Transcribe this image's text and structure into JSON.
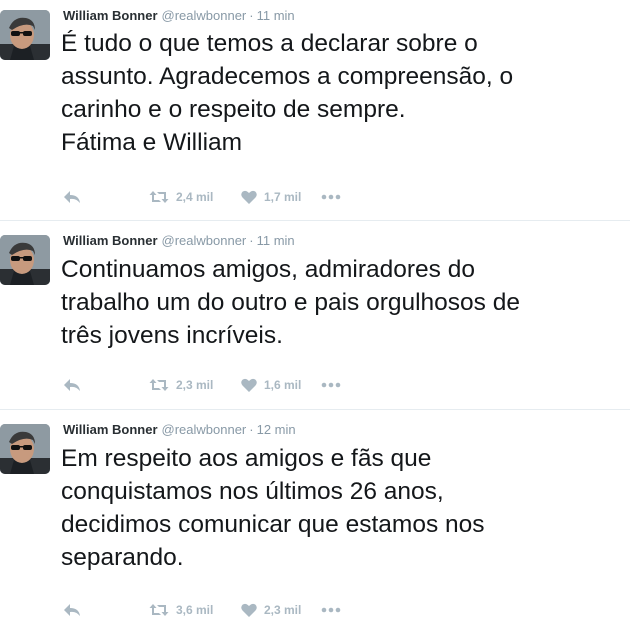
{
  "tweets": [
    {
      "name": "William Bonner",
      "handle": "@realwbonner",
      "separator": "·",
      "time": "11 min",
      "text": "É tudo o que temos a declarar sobre o\nassunto. Agradecemos a compreensão, o\ncarinho e o respeito de sempre.\nFátima e William",
      "retweets": "2,4 mil",
      "likes": "1,7 mil"
    },
    {
      "name": "William Bonner",
      "handle": "@realwbonner",
      "separator": "·",
      "time": "11 min",
      "text": "Continuamos amigos, admiradores do\ntrabalho um do outro e pais orgulhosos de\ntrês jovens incríveis.",
      "retweets": "2,3 mil",
      "likes": "1,6 mil"
    },
    {
      "name": "William Bonner",
      "handle": "@realwbonner",
      "separator": "·",
      "time": "12 min",
      "text": "Em respeito aos amigos e fãs que\nconquistamos nos últimos 26 anos,\ndecidimos comunicar que estamos nos\nseparando.",
      "retweets": "3,6 mil",
      "likes": "2,3 mil"
    }
  ],
  "icons": {
    "reply": "reply-icon",
    "retweet": "retweet-icon",
    "like": "heart-icon",
    "more": "more-icon"
  },
  "colors": {
    "action_gray": "#aab8c2",
    "meta_gray": "#8899a6",
    "divider": "#e6ecf0"
  }
}
